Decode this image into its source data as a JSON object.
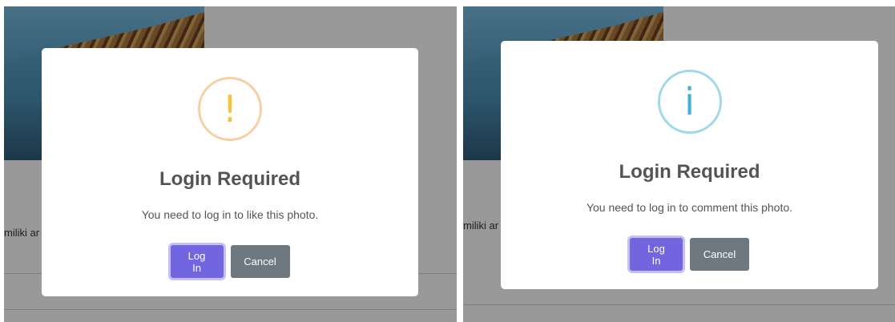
{
  "left_dialog": {
    "icon": "exclamation-warning-icon",
    "icon_glyph": "!",
    "title": "Login Required",
    "message": "You need to log in to like this photo.",
    "login_label": "Log In",
    "cancel_label": "Cancel",
    "background_text": "miliki ar"
  },
  "right_dialog": {
    "icon": "info-icon",
    "icon_glyph": "i",
    "title": "Login Required",
    "message": "You need to log in to comment this photo.",
    "login_label": "Log In",
    "cancel_label": "Cancel",
    "background_text": "miliki ar"
  },
  "colors": {
    "overlay": "#000000",
    "login_button": "#7266e0",
    "cancel_button": "#6e7881",
    "warning_icon": "#f7c33c",
    "info_icon": "#3fb1d1",
    "title_text": "#545454"
  }
}
